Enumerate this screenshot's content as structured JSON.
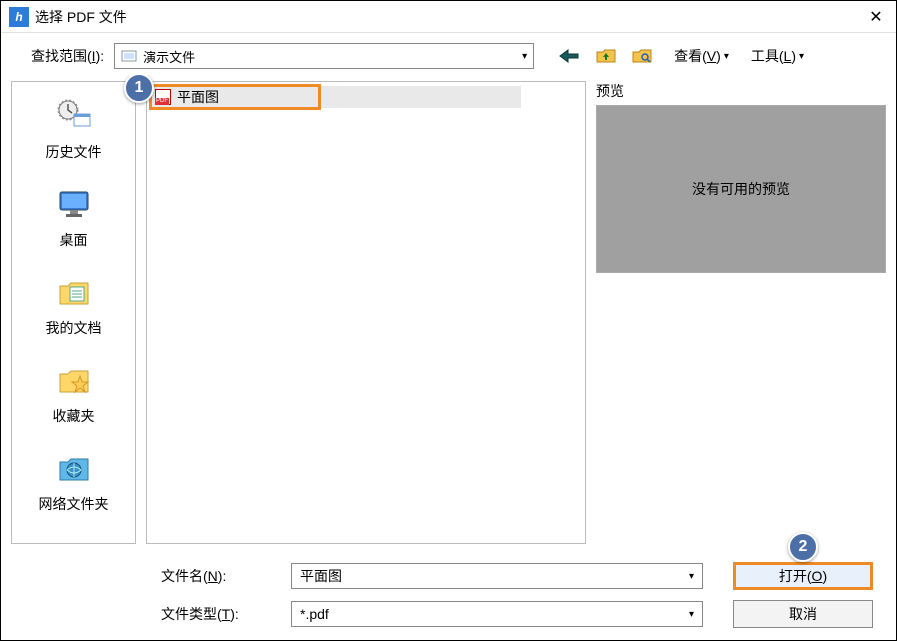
{
  "title": "选择 PDF 文件",
  "lookin_label": "查找范围(I):",
  "lookin_value": "演示文件",
  "toolbar": {
    "view_label": "查看(V)",
    "tools_label": "工具(L)"
  },
  "sidebar": {
    "history": "历史文件",
    "desktop": "桌面",
    "documents": "我的文档",
    "favorites": "收藏夹",
    "network": "网络文件夹"
  },
  "file_list": {
    "items": [
      {
        "name": "平面图"
      }
    ]
  },
  "preview": {
    "label": "预览",
    "empty_text": "没有可用的预览"
  },
  "filename_label": "文件名(N):",
  "filename_value": "平面图",
  "filetype_label": "文件类型(T):",
  "filetype_value": "*.pdf",
  "buttons": {
    "open": "打开(O)",
    "cancel": "取消"
  },
  "callouts": {
    "one": "1",
    "two": "2"
  }
}
